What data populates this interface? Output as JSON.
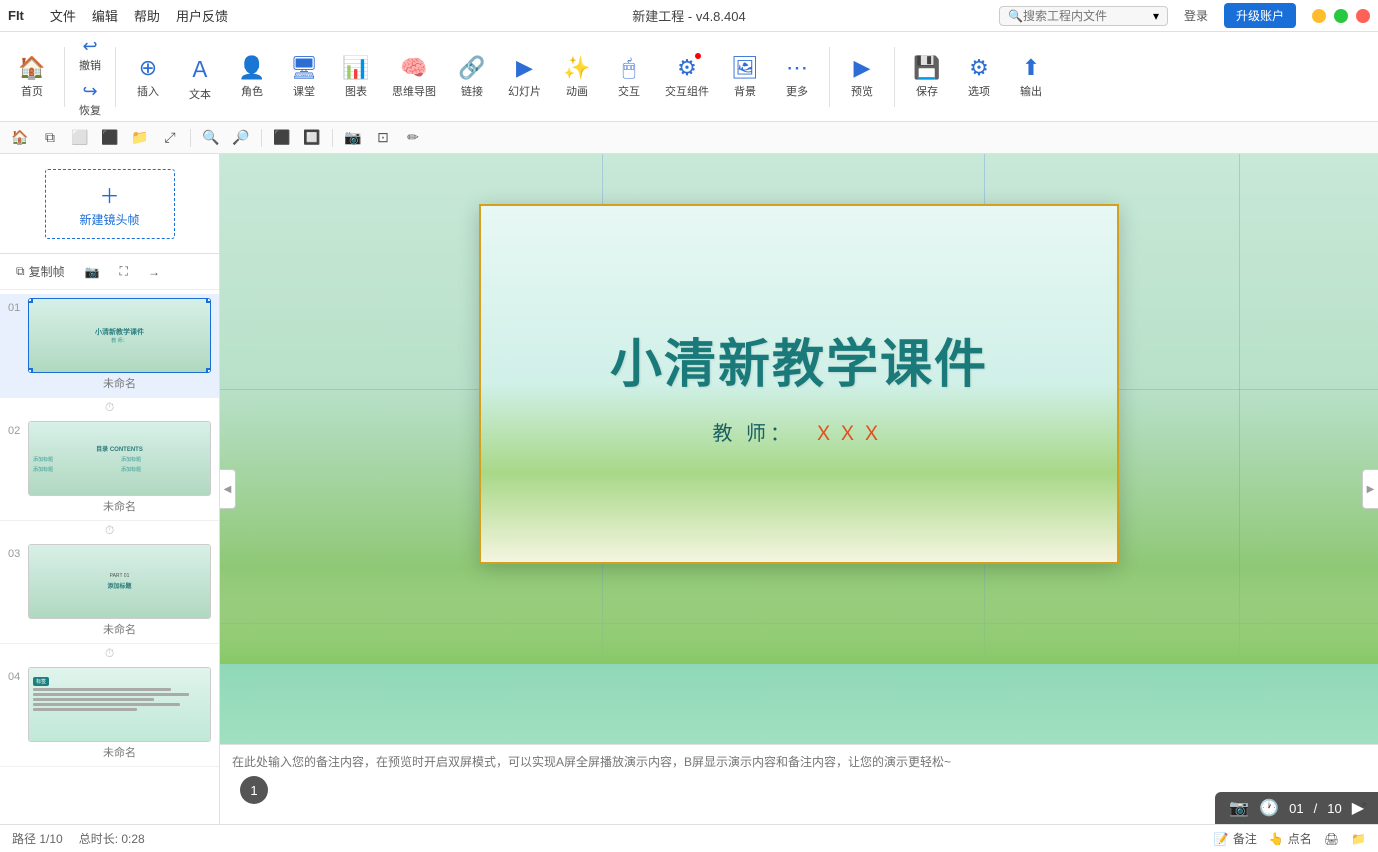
{
  "app": {
    "title": "新建工程 - v4.8.404",
    "logo": "FIt"
  },
  "titlebar": {
    "menus": [
      "文件",
      "编辑",
      "帮助",
      "用户反馈"
    ],
    "search_placeholder": "搜索工程内文件",
    "login_label": "登录",
    "upgrade_label": "升级账户"
  },
  "toolbar": {
    "home": "首页",
    "undo": "撤销",
    "redo": "恢复",
    "insert": "插入",
    "text": "文本",
    "role": "角色",
    "classroom": "课堂",
    "chart": "图表",
    "mindmap": "思维导图",
    "link": "链接",
    "slide": "幻灯片",
    "animation": "动画",
    "interact": "交互",
    "interact_group": "交互组件",
    "background": "背景",
    "more": "更多",
    "preview": "预览",
    "save": "保存",
    "options": "选项",
    "export": "输出"
  },
  "frame_actions": {
    "copy": "复制帧",
    "screenshot": "📷",
    "fullscreen": "⛶",
    "arrow": "→",
    "new_frame": "新建镜头帧"
  },
  "slides": [
    {
      "num": "01",
      "name": "未命名",
      "active": true,
      "title": "小清新教学课件",
      "sub": "教 师："
    },
    {
      "num": "02",
      "name": "未命名",
      "active": false,
      "label": "目录 CONTENTS",
      "items": [
        "添加标题",
        "添加标题",
        "添加标题",
        "添加标题"
      ]
    },
    {
      "num": "03",
      "name": "未命名",
      "active": false,
      "part": "PART 01",
      "section": "添加标题"
    },
    {
      "num": "04",
      "name": "未命名",
      "active": false
    }
  ],
  "canvas": {
    "slide_title": "小清新教学课件",
    "slide_teacher_label": "教 师：",
    "slide_teacher_name": "ＸＸＸ",
    "page_badge": "1"
  },
  "playback": {
    "current": "01",
    "total": "10",
    "separator": "/"
  },
  "notes": {
    "placeholder": "在此处输入您的备注内容，在预览时开启双屏模式，可以实现A屏全屏播放演示内容，B屏显示演示内容和备注内容，让您的演示更轻松~"
  },
  "statusbar": {
    "slide_info": "路径 1/10",
    "duration": "总时长: 0:28",
    "notes_label": "备注",
    "pointer_label": "点名",
    "icon1": "🖨",
    "icon2": "📁"
  }
}
